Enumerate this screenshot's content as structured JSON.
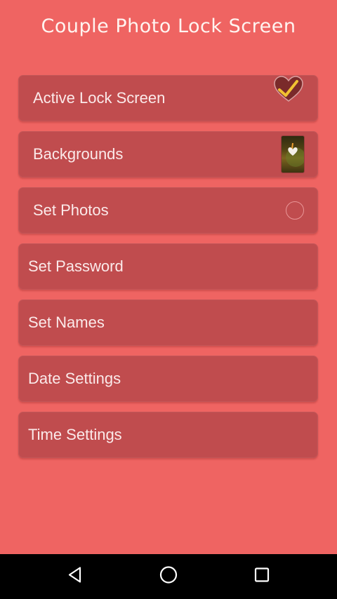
{
  "app": {
    "title": "Couple Photo Lock Screen"
  },
  "menu": {
    "items": [
      {
        "label": "Active Lock Screen",
        "icon": "heart-check-icon"
      },
      {
        "label": "Backgrounds",
        "icon": "background-thumbnail"
      },
      {
        "label": "Set Photos",
        "icon": "radio-circle-icon"
      },
      {
        "label": "Set Password"
      },
      {
        "label": "Set Names"
      },
      {
        "label": "Date Settings"
      },
      {
        "label": "Time Settings"
      }
    ]
  },
  "navbar": {
    "buttons": [
      "back-icon",
      "home-icon",
      "recents-icon"
    ]
  },
  "colors": {
    "background": "#ef6462",
    "item": "#c04c4e",
    "checkmark": "#f1c232"
  }
}
